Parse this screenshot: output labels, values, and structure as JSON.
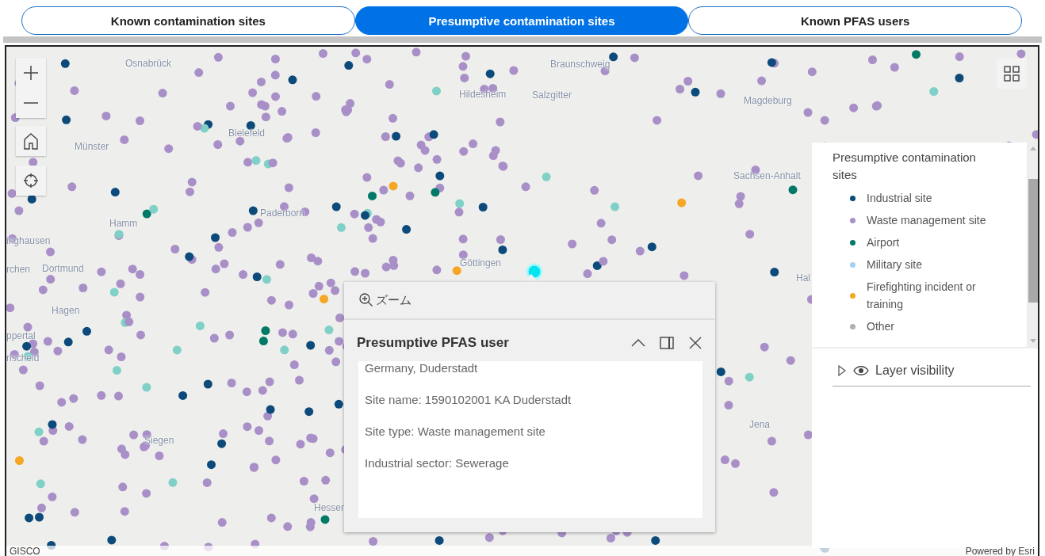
{
  "tabs": [
    {
      "label": "Known contamination sites",
      "selected": false
    },
    {
      "label": "Presumptive contamination sites",
      "selected": true
    },
    {
      "label": "Known PFAS users",
      "selected": false
    }
  ],
  "map": {
    "labels": [
      "Osnabrück",
      "Münster",
      "Bielefeld",
      "Paderborn",
      "Hamm",
      "inghausen",
      "rchen",
      "Dortmund",
      "Hagen",
      "ppertal",
      "nscheid",
      "Siegen",
      "Hessen",
      "Braunschweig",
      "Hildesheim",
      "Salzgitter",
      "Magdeburg",
      "Sachsen-Anhalt",
      "Göttingen",
      "Jena",
      "Hal"
    ],
    "attribution_left": "GISCO",
    "attribution_right": "Powered by Esri"
  },
  "popup": {
    "action": "ズーム",
    "title": "Presumptive PFAS user",
    "lines": [
      "Germany, Duderstadt",
      "Site name: 1590102001 KA Duderstadt",
      "Site type: Waste management site",
      "Industrial sector: Sewerage"
    ]
  },
  "legend": {
    "title": "Presumptive contamination sites",
    "items": [
      {
        "label": "Industrial site",
        "color": "#0b4a7a"
      },
      {
        "label": "Waste management site",
        "color": "#a98fc8"
      },
      {
        "label": "Airport",
        "color": "#007a66"
      },
      {
        "label": "Military site",
        "color": "#a6cff0"
      },
      {
        "label": "Firefighting incident or training",
        "color": "#f5a623"
      },
      {
        "label": "Other",
        "color": "#b0b0b0"
      }
    ],
    "layer_visibility": {
      "label": "Layer visibility",
      "expanded": false
    }
  }
}
